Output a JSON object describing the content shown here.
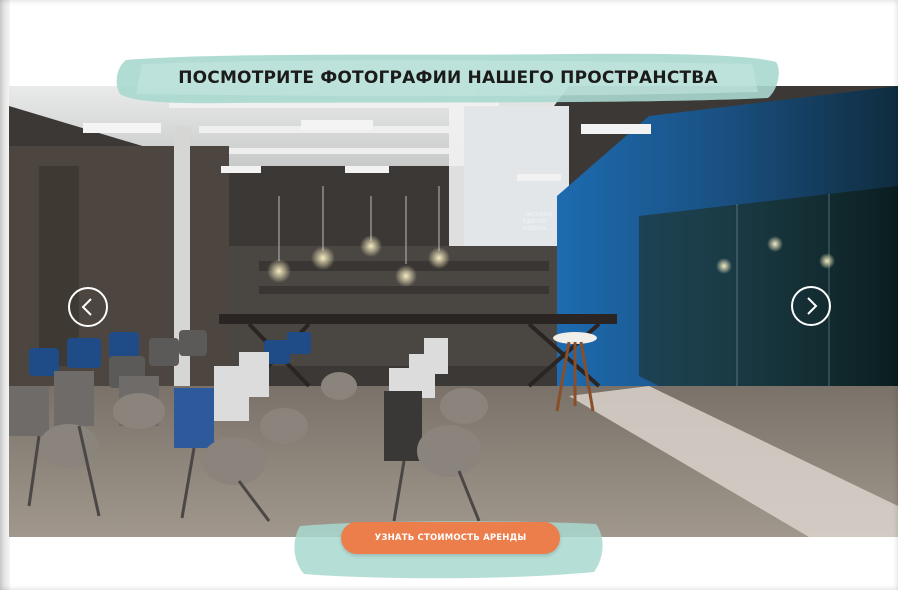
{
  "page": {
    "title": "ПОСМОТРИТЕ ФОТОГРАФИИ НАШЕГО ПРОСТРАНСТВА",
    "cta_label": "УЗНАТЬ СТОИМОСТЬ АРЕНДЫ"
  },
  "gallery": {
    "photo_description_icon": "conference-room-photo",
    "prev_icon": "chevron-left-icon",
    "next_icon": "chevron-right-icon",
    "wall_sign_text": "„ИСТИНА ГДЕ-ТО РЯДОМ..."
  },
  "colors": {
    "accent_button": "#ec7e4b",
    "brush_mint": "#a8d8cf",
    "title_text": "#1b1b1b",
    "wall_blue": "#1f5f9a"
  }
}
